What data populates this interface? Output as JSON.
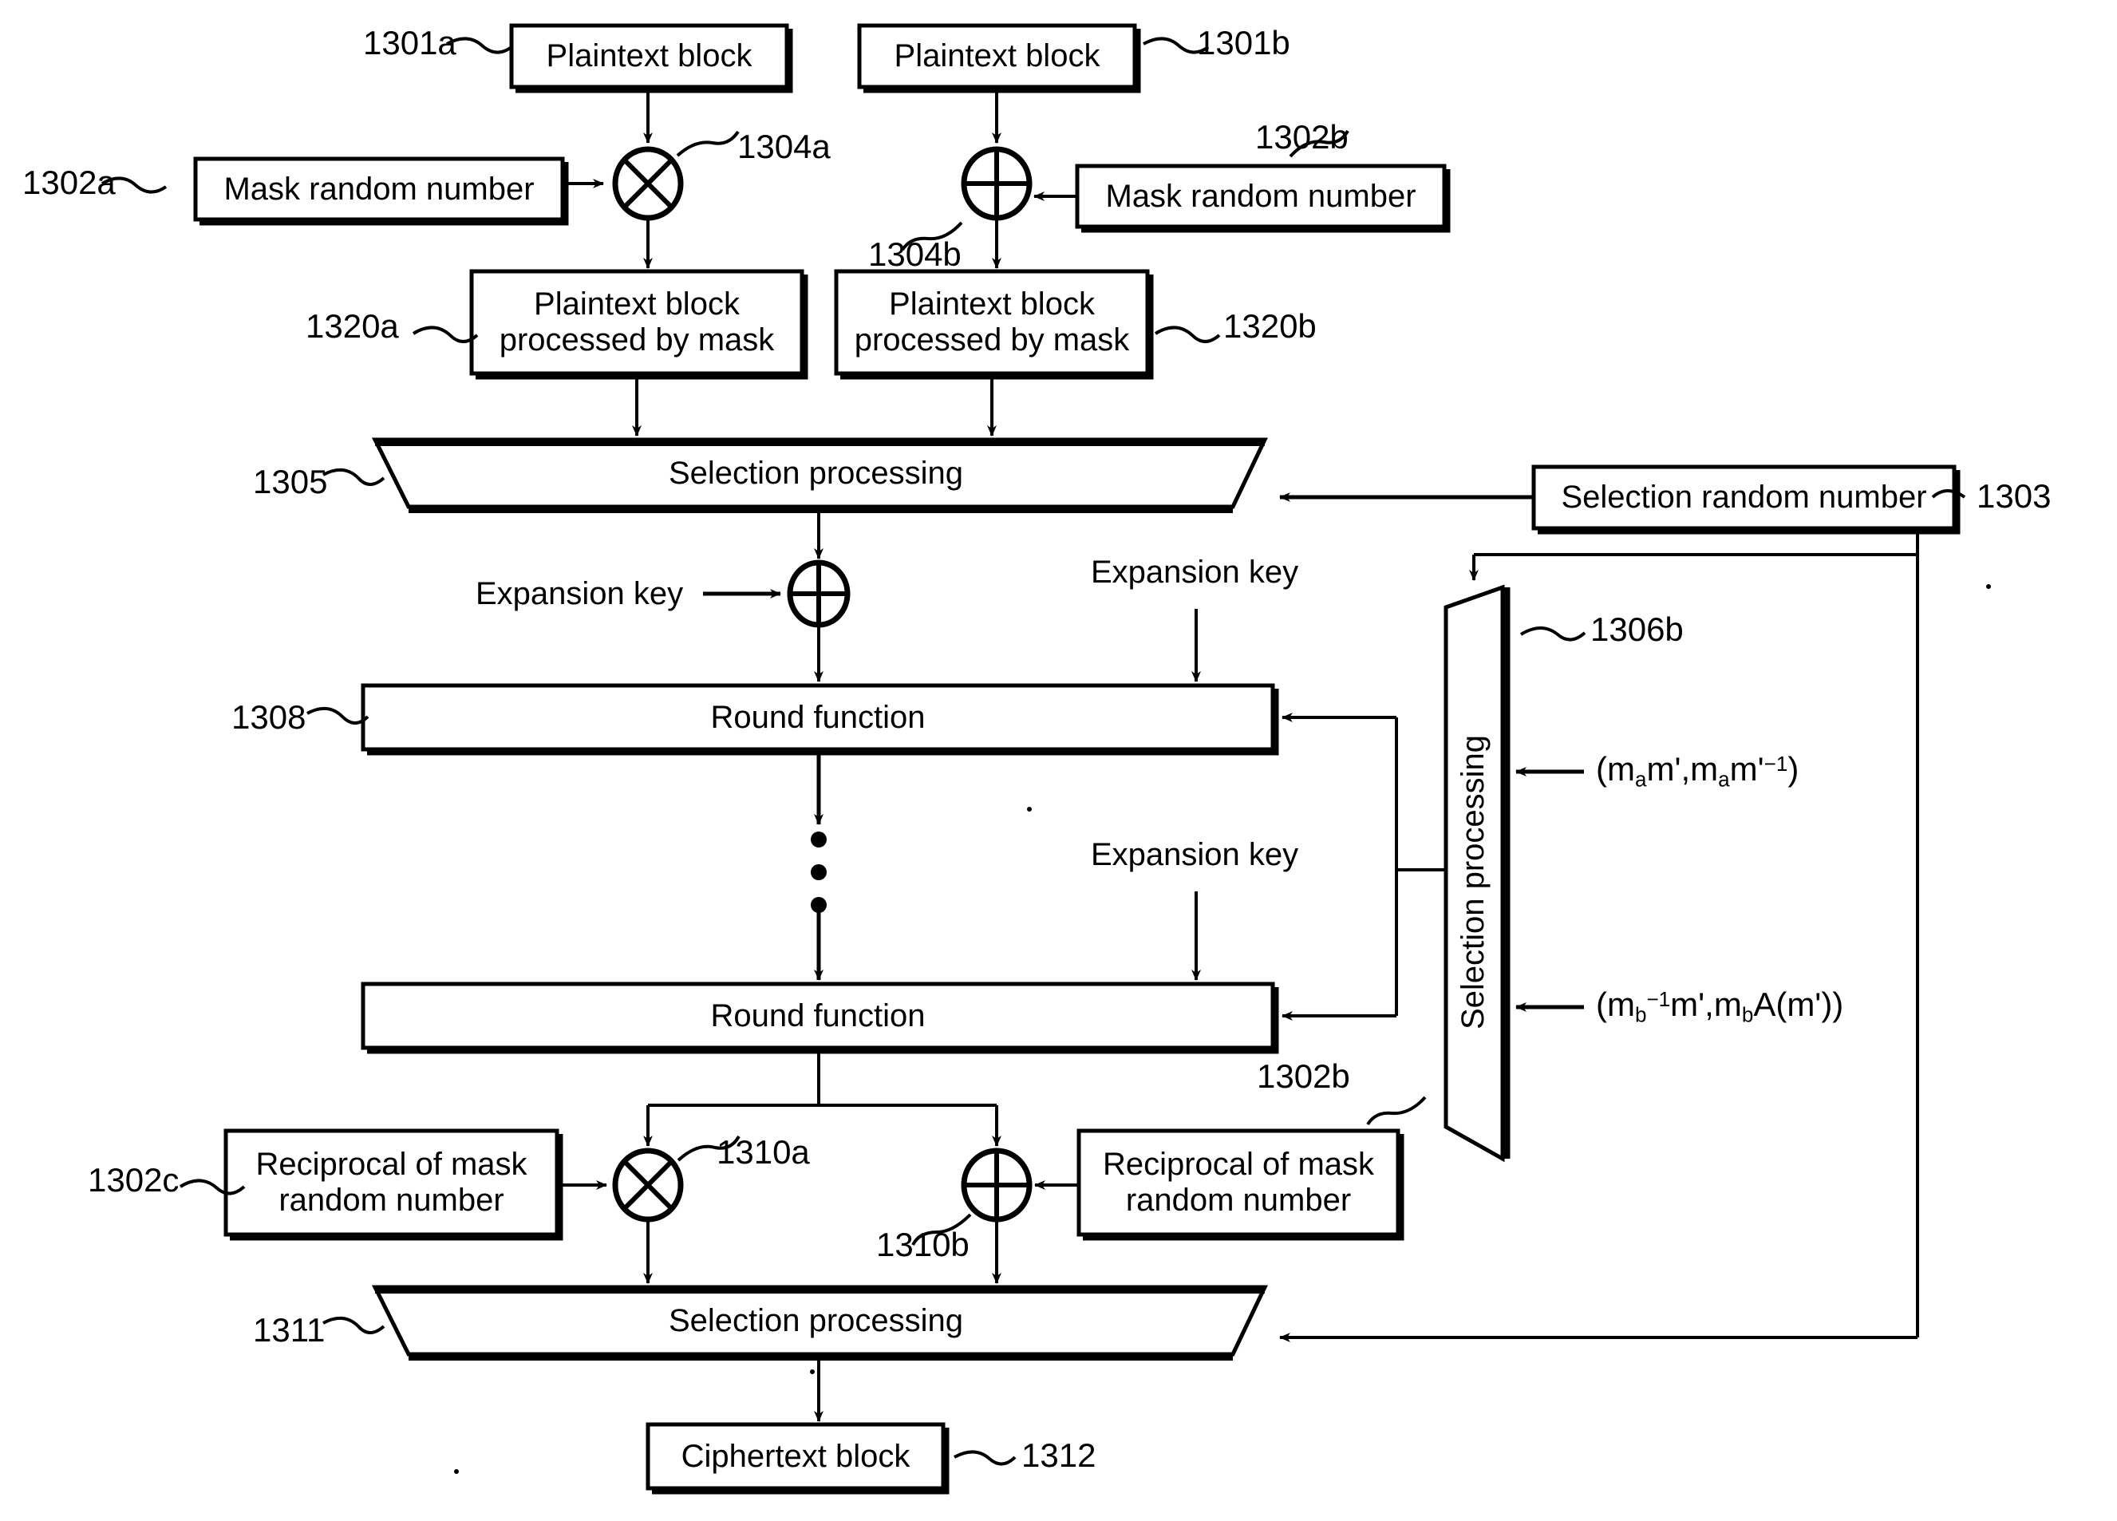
{
  "figure": {
    "type": "patent-block-diagram",
    "title": "",
    "background": "#ffffff",
    "ink": "#000000"
  },
  "nodes": {
    "plaintext_a": {
      "label": "Plaintext block",
      "ref": "1301a"
    },
    "plaintext_b": {
      "label": "Plaintext block",
      "ref": "1301b"
    },
    "mask_a": {
      "label": "Mask random number",
      "ref": "1302a"
    },
    "mask_b": {
      "label": "Mask random number",
      "ref": "1302b"
    },
    "op_mul_a": {
      "icon": "circle-times-icon",
      "ref": "1304a"
    },
    "op_xor_b": {
      "icon": "circle-plus-icon",
      "ref": "1304b"
    },
    "masked_a": {
      "line1": "Plaintext block",
      "line2": "processed by mask",
      "ref": "1320a"
    },
    "masked_b": {
      "line1": "Plaintext block",
      "line2": "processed by mask",
      "ref": "1320b"
    },
    "selection_top": {
      "label": "Selection processing",
      "ref": "1305"
    },
    "selection_random": {
      "label": "Selection random number",
      "ref": "1303"
    },
    "expansion_key_1": {
      "label": "Expansion key"
    },
    "expansion_key_2": {
      "label": "Expansion key"
    },
    "expansion_key_3": {
      "label": "Expansion key"
    },
    "op_xor_key": {
      "icon": "circle-plus-icon"
    },
    "round_function_1": {
      "label": "Round function",
      "ref": "1308"
    },
    "round_function_2": {
      "label": "Round function"
    },
    "ellipsis": {
      "label": "•••"
    },
    "selection_side": {
      "label": "Selection processing",
      "ref": "1306b"
    },
    "formula_a": {
      "text": "(m_a m', m_a m'^-1)"
    },
    "formula_b": {
      "text": "(m_b^-1 m', m_b A(m'))"
    },
    "recip_mask_c": {
      "line1": "Reciprocal of mask",
      "line2": "random number",
      "ref": "1302c"
    },
    "recip_mask_b": {
      "line1": "Reciprocal of mask",
      "line2": "random number",
      "ref": "1302b"
    },
    "op_mul_out": {
      "icon": "circle-times-icon",
      "ref": "1310a"
    },
    "op_xor_out": {
      "icon": "circle-plus-icon",
      "ref": "1310b"
    },
    "selection_bottom": {
      "label": "Selection processing",
      "ref": "1311"
    },
    "ciphertext": {
      "label": "Ciphertext block",
      "ref": "1312"
    }
  }
}
